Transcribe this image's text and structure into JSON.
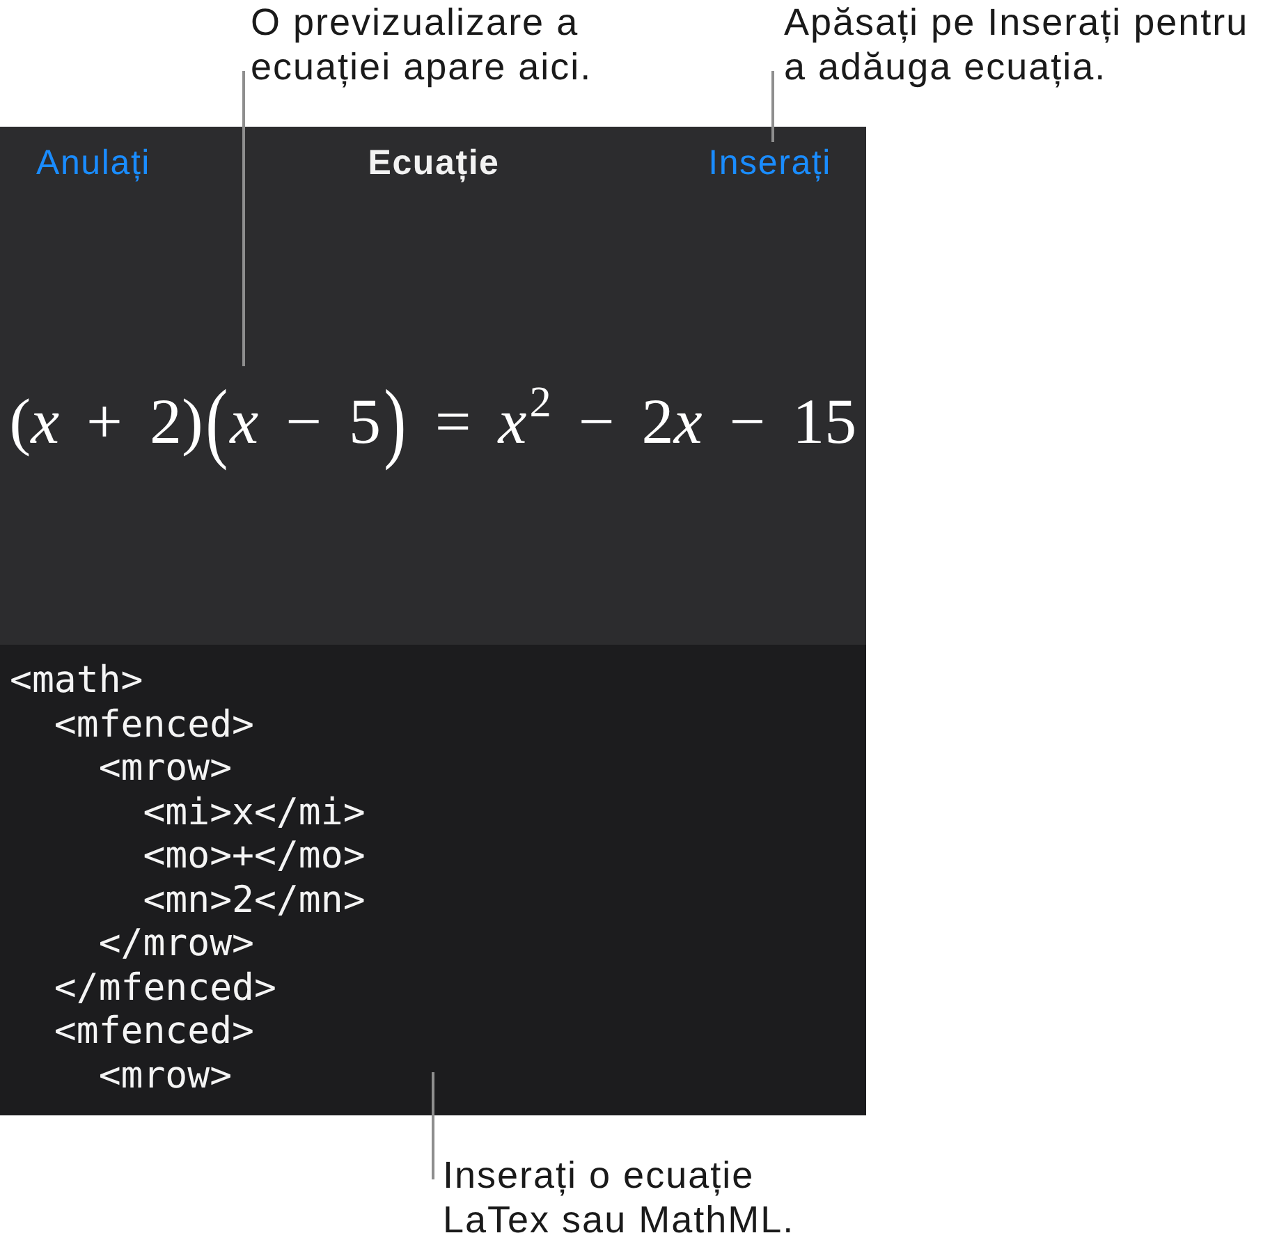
{
  "annotations": {
    "preview": "O previzualizare a\necuației apare aici.",
    "insert": "Apăsați pe Inserați pentru\na adăuga ecuația.",
    "editor": "Inserați o ecuație\nLaTex sau MathML."
  },
  "header": {
    "cancel": "Anulați",
    "title": "Ecuație",
    "insert": "Inserați"
  },
  "preview": {
    "equation": [
      {
        "kind": "text",
        "text": "("
      },
      {
        "kind": "variable",
        "text": "x"
      },
      {
        "kind": "text",
        "text": " + 2)"
      },
      {
        "kind": "fence",
        "text": "("
      },
      {
        "kind": "variable",
        "text": "x"
      },
      {
        "kind": "text",
        "text": " − 5"
      },
      {
        "kind": "fence",
        "text": ")"
      },
      {
        "kind": "text",
        "text": " = "
      },
      {
        "kind": "variable",
        "text": "x"
      },
      {
        "kind": "superscript",
        "text": "2"
      },
      {
        "kind": "text",
        "text": " − 2"
      },
      {
        "kind": "variable",
        "text": "x"
      },
      {
        "kind": "text",
        "text": " − 15"
      }
    ]
  },
  "editor": {
    "value": "<math>\n  <mfenced>\n    <mrow>\n      <mi>x</mi>\n      <mo>+</mo>\n      <mn>2</mn>\n    </mrow>\n  </mfenced>\n  <mfenced>\n    <mrow>"
  }
}
